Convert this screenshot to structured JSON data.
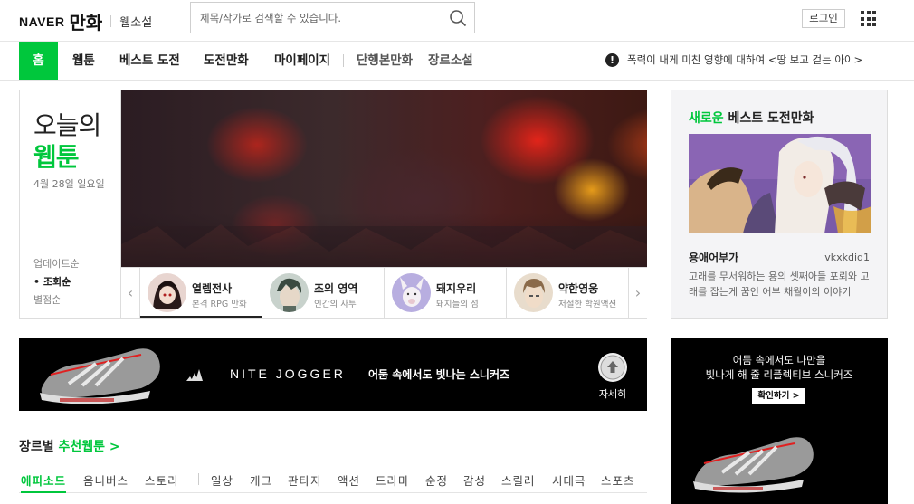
{
  "header": {
    "logo_naver": "NAVER",
    "logo_manhwa": "만화",
    "logo_novel": "웹소설",
    "search_placeholder": "제목/작가로 검색할 수 있습니다.",
    "login": "로그인"
  },
  "nav": {
    "items": [
      {
        "label": "홈"
      },
      {
        "label": "웹툰"
      },
      {
        "label": "베스트 도전"
      },
      {
        "label": "도전만화"
      },
      {
        "label": "마이페이지"
      },
      {
        "label": "단행본만화"
      },
      {
        "label": "장르소설"
      }
    ],
    "notice": "폭력이 내게 미친 영향에 대하여 <땅 보고 걷는 아이>"
  },
  "today": {
    "title_line1": "오늘의",
    "title_line2": "웹툰",
    "date": "4월 28일 일요일",
    "sort_options": [
      {
        "label": "업데이트순"
      },
      {
        "label": "• 조회순"
      },
      {
        "label": "별점순"
      }
    ],
    "thumbnails": [
      {
        "name": "열렙전사",
        "desc": "본격 RPG 만화"
      },
      {
        "name": "조의 영역",
        "desc": "인간의 사투"
      },
      {
        "name": "돼지우리",
        "desc": "돼지들의 섬"
      },
      {
        "name": "약한영웅",
        "desc": "처절한 학원액션"
      }
    ]
  },
  "challenge": {
    "title_green": "새로운",
    "title_rest": " 베스트 도전만화",
    "work_title": "용애어부가",
    "author": "vkxkdid1",
    "description": "고래를 무서워하는 용의 셋째아들 포뢰와 고래를 잡는게 꿈인 어부 채월이의 이야기"
  },
  "ad_main": {
    "brand": "NITE JOGGER",
    "copy": "어둠 속에서도 빛나는 스니커즈",
    "more": "자세히"
  },
  "ad_side": {
    "copy_line1": "어둠 속에서도 나만을",
    "copy_line2": "빛나게 해 줄 리플렉티브 스니커즈",
    "button": "확인하기 >"
  },
  "genre": {
    "title_prefix": "장르별 ",
    "title_green": "추천웹툰 >",
    "tabs": [
      {
        "label": "에피소드"
      },
      {
        "label": "옴니버스"
      },
      {
        "label": "스토리"
      },
      {
        "label": "일상"
      },
      {
        "label": "개그"
      },
      {
        "label": "판타지"
      },
      {
        "label": "액션"
      },
      {
        "label": "드라마"
      },
      {
        "label": "순정"
      },
      {
        "label": "감성"
      },
      {
        "label": "스릴러"
      },
      {
        "label": "시대극"
      },
      {
        "label": "스포츠"
      }
    ]
  },
  "colors": {
    "brand_green": "#00c73c"
  }
}
